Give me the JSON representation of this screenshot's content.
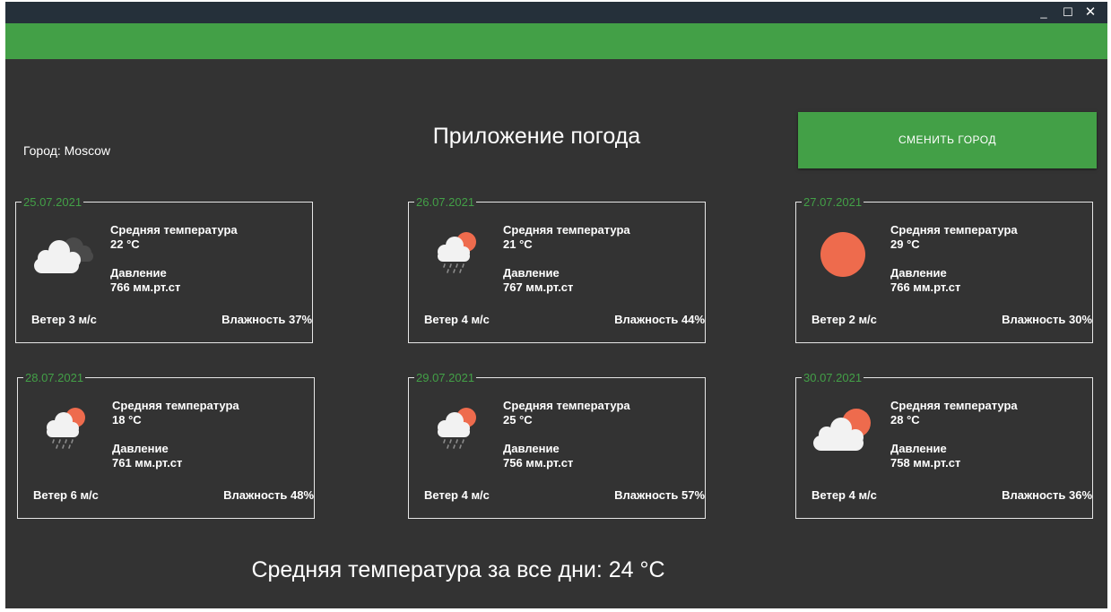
{
  "window_controls": {
    "minimize": "_",
    "maximize": "☐",
    "close": "✕"
  },
  "header": {
    "city_text": "Город: Moscow",
    "title": "Приложение погода",
    "change_city_label": "СМЕНИТЬ ГОРОД"
  },
  "colors": {
    "accent": "#43a047",
    "background": "#333333",
    "sun": "#ee6b4d",
    "cloud": "#f2f2f2",
    "dark_cloud": "#4a4a4a",
    "titlebar": "#25303a"
  },
  "cards": [
    {
      "date": "25.07.2021",
      "icon": "cloudy-icon",
      "temp_label": "Средняя температура",
      "temp_value": "22 °C",
      "pressure_label": "Давление",
      "pressure_value": "766 мм.рт.ст",
      "wind": "Ветер 3 м/с",
      "humidity": "Влажность 37%"
    },
    {
      "date": "26.07.2021",
      "icon": "rain-sun-icon",
      "temp_label": "Средняя температура",
      "temp_value": "21 °C",
      "pressure_label": "Давление",
      "pressure_value": "767 мм.рт.ст",
      "wind": "Ветер 4 м/с",
      "humidity": "Влажность 44%"
    },
    {
      "date": "27.07.2021",
      "icon": "sun-icon",
      "temp_label": "Средняя температура",
      "temp_value": "29 °C",
      "pressure_label": "Давление",
      "pressure_value": "766 мм.рт.ст",
      "wind": "Ветер 2 м/с",
      "humidity": "Влажность 30%"
    },
    {
      "date": "28.07.2021",
      "icon": "rain-sun-icon",
      "temp_label": "Средняя температура",
      "temp_value": "18 °C",
      "pressure_label": "Давление",
      "pressure_value": "761 мм.рт.ст",
      "wind": "Ветер 6 м/с",
      "humidity": "Влажность 48%"
    },
    {
      "date": "29.07.2021",
      "icon": "rain-sun-icon",
      "temp_label": "Средняя температура",
      "temp_value": "25 °C",
      "pressure_label": "Давление",
      "pressure_value": "756 мм.рт.ст",
      "wind": "Ветер 4 м/с",
      "humidity": "Влажность 57%"
    },
    {
      "date": "30.07.2021",
      "icon": "partly-cloudy-icon",
      "temp_label": "Средняя температура",
      "temp_value": "28 °C",
      "pressure_label": "Давление",
      "pressure_value": "758 мм.рт.ст",
      "wind": "Ветер 4 м/с",
      "humidity": "Влажность 36%"
    }
  ],
  "footer": {
    "average_text": "Средняя температура за все дни: 24 °C"
  }
}
